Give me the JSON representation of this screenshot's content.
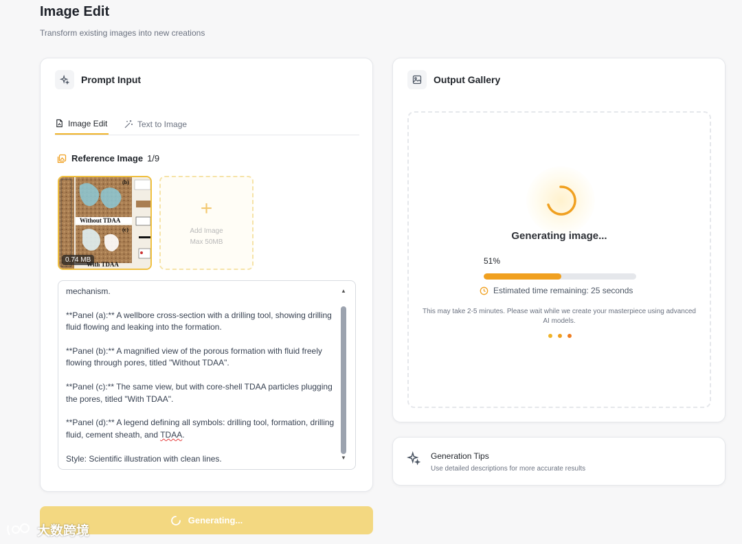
{
  "page": {
    "title": "Image Edit",
    "subtitle": "Transform existing images into new creations"
  },
  "prompt_card": {
    "title": "Prompt Input",
    "icon": "sparkles-icon",
    "tabs": [
      {
        "label": "Image Edit",
        "icon": "image-edit-icon",
        "active": true
      },
      {
        "label": "Text to Image",
        "icon": "magic-wand-icon",
        "active": false
      }
    ],
    "reference": {
      "label": "Reference Image",
      "count": "1/9",
      "thumbnail": {
        "size": "0.74 MB",
        "text_without": "Without TDAA",
        "text_with": "With TDAA",
        "panel_b": "(b)",
        "panel_c": "(c)"
      },
      "add_image": {
        "label": "Add Image",
        "limit": "Max 50MB"
      }
    },
    "prompt_text": "mechanism.\n\n**Panel (a):** A wellbore cross-section with a drilling tool, showing drilling fluid flowing and leaking into the formation.\n\n**Panel (b):** A magnified view of the porous formation with fluid freely flowing through pores, titled \"Without TDAA\".\n\n**Panel (c):** The same view, but with core-shell TDAA particles plugging the pores, titled \"With TDAA\".\n\n**Panel (d):** A legend defining all symbols: drilling tool, formation, drilling fluid, cement sheath, and ",
    "prompt_text_squiggle": "TDAA",
    "prompt_text_tail": ".\n\nStyle: Scientific illustration with clean lines."
  },
  "generate_button": {
    "label": "Generating..."
  },
  "output_card": {
    "title": "Output Gallery",
    "icon": "image-icon",
    "status": "Generating image...",
    "progress": 51,
    "progress_label": "51%",
    "eta": "Estimated time remaining: 25 seconds",
    "note": "This may take 2-5 minutes. Please wait while we create your masterpiece using advanced AI models.",
    "colors": {
      "accent": "#f0a020",
      "spinner": "#f0a020",
      "dots": [
        "#f0b429",
        "#f0a020",
        "#ef7d22"
      ]
    }
  },
  "tips_card": {
    "title": "Generation Tips",
    "desc": "Use detailed descriptions for more accurate results"
  },
  "watermark": {
    "text": "大数跨境"
  }
}
